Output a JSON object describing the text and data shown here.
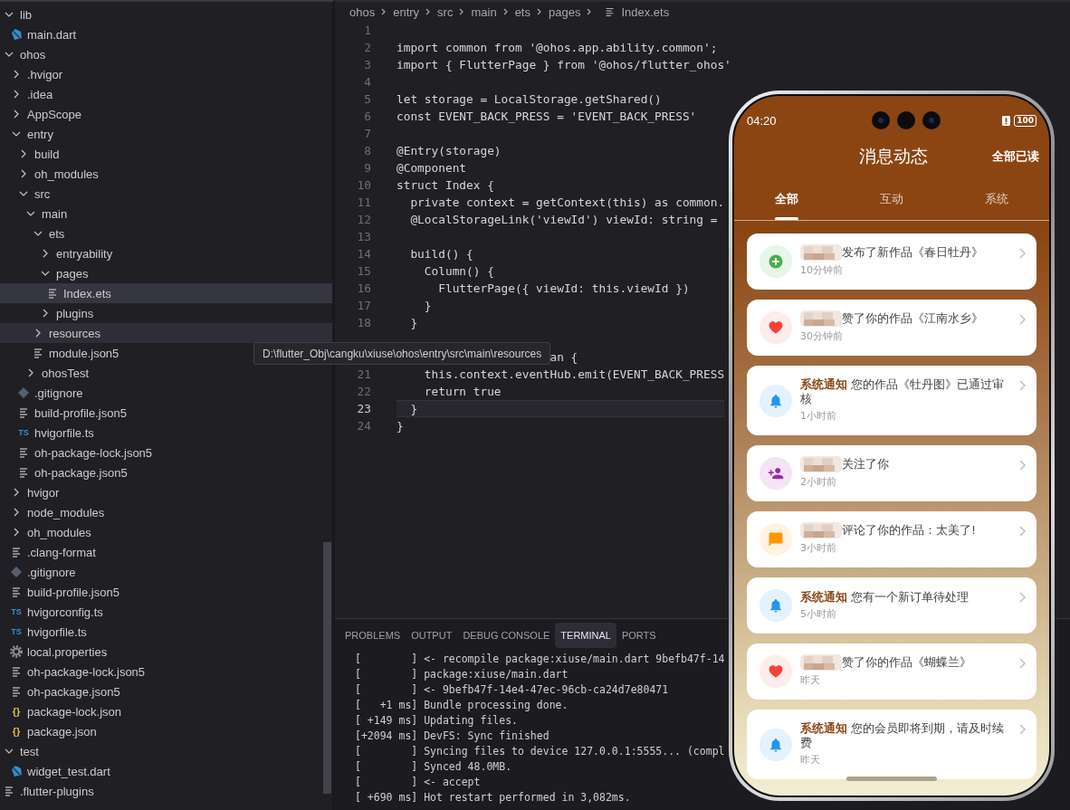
{
  "sidebar": {
    "items": [
      {
        "name": "lib",
        "kind": "folder",
        "expanded": true,
        "selected": false,
        "hovered": false,
        "children": [
          {
            "name": "main.dart",
            "kind": "dart",
            "selected": false,
            "hovered": false
          }
        ]
      },
      {
        "name": "ohos",
        "kind": "folder",
        "expanded": true,
        "selected": false,
        "hovered": false,
        "children": [
          {
            "name": ".hvigor",
            "kind": "folder",
            "expanded": false,
            "selected": false,
            "hovered": false
          },
          {
            "name": ".idea",
            "kind": "folder",
            "expanded": false,
            "selected": false,
            "hovered": false
          },
          {
            "name": "AppScope",
            "kind": "folder",
            "expanded": false,
            "selected": false,
            "hovered": false
          },
          {
            "name": "entry",
            "kind": "folder",
            "expanded": true,
            "selected": false,
            "hovered": false,
            "children": [
              {
                "name": "build",
                "kind": "folder",
                "expanded": false,
                "selected": false,
                "hovered": false
              },
              {
                "name": "oh_modules",
                "kind": "folder",
                "expanded": false,
                "selected": false,
                "hovered": false
              },
              {
                "name": "src",
                "kind": "folder",
                "expanded": true,
                "selected": false,
                "hovered": false,
                "children": [
                  {
                    "name": "main",
                    "kind": "folder",
                    "expanded": true,
                    "selected": false,
                    "hovered": false,
                    "children": [
                      {
                        "name": "ets",
                        "kind": "folder",
                        "expanded": true,
                        "selected": false,
                        "hovered": false,
                        "children": [
                          {
                            "name": "entryability",
                            "kind": "folder",
                            "expanded": false,
                            "selected": false,
                            "hovered": false
                          },
                          {
                            "name": "pages",
                            "kind": "folder",
                            "expanded": true,
                            "selected": false,
                            "hovered": false,
                            "children": [
                              {
                                "name": "Index.ets",
                                "kind": "text",
                                "selected": true,
                                "hovered": false
                              }
                            ]
                          },
                          {
                            "name": "plugins",
                            "kind": "folder",
                            "expanded": false,
                            "selected": false,
                            "hovered": false
                          }
                        ]
                      },
                      {
                        "name": "resources",
                        "kind": "folder",
                        "expanded": false,
                        "selected": false,
                        "hovered": true
                      },
                      {
                        "name": "module.json5",
                        "kind": "text",
                        "selected": false,
                        "hovered": false
                      }
                    ]
                  },
                  {
                    "name": "ohosTest",
                    "kind": "folder",
                    "expanded": false,
                    "selected": false,
                    "hovered": false
                  }
                ]
              },
              {
                "name": ".gitignore",
                "kind": "git",
                "selected": false,
                "hovered": false
              },
              {
                "name": "build-profile.json5",
                "kind": "text",
                "selected": false,
                "hovered": false
              },
              {
                "name": "hvigorfile.ts",
                "kind": "ts",
                "badge": "TS",
                "selected": false,
                "hovered": false
              },
              {
                "name": "oh-package-lock.json5",
                "kind": "text",
                "selected": false,
                "hovered": false
              },
              {
                "name": "oh-package.json5",
                "kind": "text",
                "selected": false,
                "hovered": false
              }
            ]
          },
          {
            "name": "hvigor",
            "kind": "folder",
            "expanded": false,
            "selected": false,
            "hovered": false
          },
          {
            "name": "node_modules",
            "kind": "folder",
            "expanded": false,
            "selected": false,
            "hovered": false
          },
          {
            "name": "oh_modules",
            "kind": "folder",
            "expanded": false,
            "selected": false,
            "hovered": false
          },
          {
            "name": ".clang-format",
            "kind": "text",
            "selected": false,
            "hovered": false
          },
          {
            "name": ".gitignore",
            "kind": "git",
            "selected": false,
            "hovered": false
          },
          {
            "name": "build-profile.json5",
            "kind": "text",
            "selected": false,
            "hovered": false
          },
          {
            "name": "hvigorconfig.ts",
            "kind": "ts",
            "badge": "TS",
            "selected": false,
            "hovered": false
          },
          {
            "name": "hvigorfile.ts",
            "kind": "ts",
            "badge": "TS",
            "selected": false,
            "hovered": false
          },
          {
            "name": "local.properties",
            "kind": "gear",
            "selected": false,
            "hovered": false
          },
          {
            "name": "oh-package-lock.json5",
            "kind": "text",
            "selected": false,
            "hovered": false
          },
          {
            "name": "oh-package.json5",
            "kind": "text",
            "selected": false,
            "hovered": false
          },
          {
            "name": "package-lock.json",
            "kind": "json",
            "badge": "{}",
            "selected": false,
            "hovered": false
          },
          {
            "name": "package.json",
            "kind": "json",
            "badge": "{}",
            "selected": false,
            "hovered": false
          }
        ]
      },
      {
        "name": "test",
        "kind": "folder",
        "expanded": true,
        "selected": false,
        "hovered": false,
        "children": [
          {
            "name": "widget_test.dart",
            "kind": "dart",
            "selected": false,
            "hovered": false
          }
        ]
      },
      {
        "name": ".flutter-plugins",
        "kind": "text",
        "selected": false,
        "hovered": false
      }
    ]
  },
  "editor": {
    "breadcrumb": [
      "ohos",
      "entry",
      "src",
      "main",
      "ets",
      "pages"
    ],
    "file": "Index.ets",
    "lines": [
      {
        "kind": "code",
        "number": "1",
        "current": false
      },
      {
        "kind": "code",
        "number": "2",
        "text": "import common from '@ohos.app.ability.common';",
        "current": false
      },
      {
        "kind": "code",
        "number": "3",
        "text": "import { FlutterPage } from '@ohos/flutter_ohos'",
        "current": false
      },
      {
        "kind": "code",
        "number": "4",
        "current": false
      },
      {
        "kind": "code",
        "number": "5",
        "text": "let storage = LocalStorage.getShared()",
        "current": false
      },
      {
        "kind": "code",
        "number": "6",
        "text": "const EVENT_BACK_PRESS = 'EVENT_BACK_PRESS'",
        "current": false
      },
      {
        "kind": "code",
        "number": "7",
        "current": false
      },
      {
        "kind": "code",
        "number": "8",
        "text": "@Entry(storage)",
        "current": false
      },
      {
        "kind": "code",
        "number": "9",
        "text": "@Component",
        "current": false
      },
      {
        "kind": "code",
        "number": "10",
        "text": "struct Index {",
        "current": false
      },
      {
        "kind": "code",
        "number": "11",
        "text": "  private context = getContext(this) as common.",
        "current": false
      },
      {
        "kind": "code",
        "number": "12",
        "text": "  @LocalStorageLink('viewId') viewId: string =",
        "current": false
      },
      {
        "kind": "code",
        "number": "13",
        "current": false
      },
      {
        "kind": "code",
        "number": "14",
        "text": "  build() {",
        "current": false
      },
      {
        "kind": "code",
        "number": "15",
        "text": "    Column() {",
        "current": false
      },
      {
        "kind": "code",
        "number": "16",
        "text": "      FlutterPage({ viewId: this.viewId })",
        "current": false
      },
      {
        "kind": "code",
        "number": "17",
        "text": "    }",
        "current": false
      },
      {
        "kind": "code",
        "number": "18",
        "text": "  }",
        "current": false
      },
      {
        "kind": "covered",
        "current": false
      },
      {
        "kind": "covered",
        "text": "an {",
        "current": false
      },
      {
        "kind": "code",
        "number": "21",
        "text": "    this.context.eventHub.emit(EVENT_BACK_PRESS",
        "current": false
      },
      {
        "kind": "code",
        "number": "22",
        "text": "    return true",
        "current": false
      },
      {
        "kind": "code",
        "number": "23",
        "text": "  }",
        "current": true
      },
      {
        "kind": "code",
        "number": "24",
        "text": "}",
        "current": false
      }
    ]
  },
  "tooltip": "D:\\flutter_Obj\\cangku\\xiuse\\ohos\\entry\\src\\main\\resources",
  "panel": {
    "tabs": [
      {
        "label": "PROBLEMS",
        "selected": false
      },
      {
        "label": "OUTPUT",
        "selected": false
      },
      {
        "label": "DEBUG CONSOLE",
        "selected": false
      },
      {
        "label": "TERMINAL",
        "selected": true
      },
      {
        "label": "PORTS",
        "selected": false
      }
    ],
    "terminal": [
      "[        ] <- recompile package:xiuse/main.dart 9befb47f-14",
      "[        ] package:xiuse/main.dart",
      "[        ] <- 9befb47f-14e4-47ec-96cb-ca24d7e80471",
      "[   +1 ms] Bundle processing done.",
      "[ +149 ms] Updating files.",
      "[+2094 ms] DevFS: Sync finished",
      "[        ] Syncing files to device 127.0.0.1:5555... (compl",
      "[        ] Synced 48.0MB.",
      "[        ] <- accept",
      "[ +690 ms] Hot restart performed in 3,082ms."
    ]
  },
  "phone": {
    "time": "04:20",
    "battery": "100",
    "title": "消息动态",
    "action": "全部已读",
    "tabs": [
      {
        "label": "全部",
        "selected": true
      },
      {
        "label": "互动",
        "selected": false
      },
      {
        "label": "系统",
        "selected": false
      }
    ],
    "notifications": [
      {
        "kind": "publish",
        "redacted": true,
        "text": "发布了新作品《春日牡丹》",
        "time": "10分钟前"
      },
      {
        "kind": "like",
        "redacted": true,
        "text": "赞了你的作品《江南水乡》",
        "time": "30分钟前"
      },
      {
        "kind": "system",
        "redacted": false,
        "text": "**系统通知** 您的作品《牡丹图》已通过审核",
        "time": "1小时前"
      },
      {
        "kind": "follow",
        "redacted": true,
        "text": "关注了你",
        "time": "2小时前"
      },
      {
        "kind": "comment",
        "redacted": true,
        "text": "评论了你的作品：太美了!",
        "time": "3小时前"
      },
      {
        "kind": "system",
        "redacted": false,
        "text": "**系统通知** 您有一个新订单待处理",
        "time": "5小时前"
      },
      {
        "kind": "like",
        "redacted": true,
        "text": "赞了你的作品《蝴蝶兰》",
        "time": "昨天"
      },
      {
        "kind": "system",
        "redacted": false,
        "text": "**系统通知** 您的会员即将到期，请及时续费",
        "time": "昨天"
      }
    ]
  }
}
